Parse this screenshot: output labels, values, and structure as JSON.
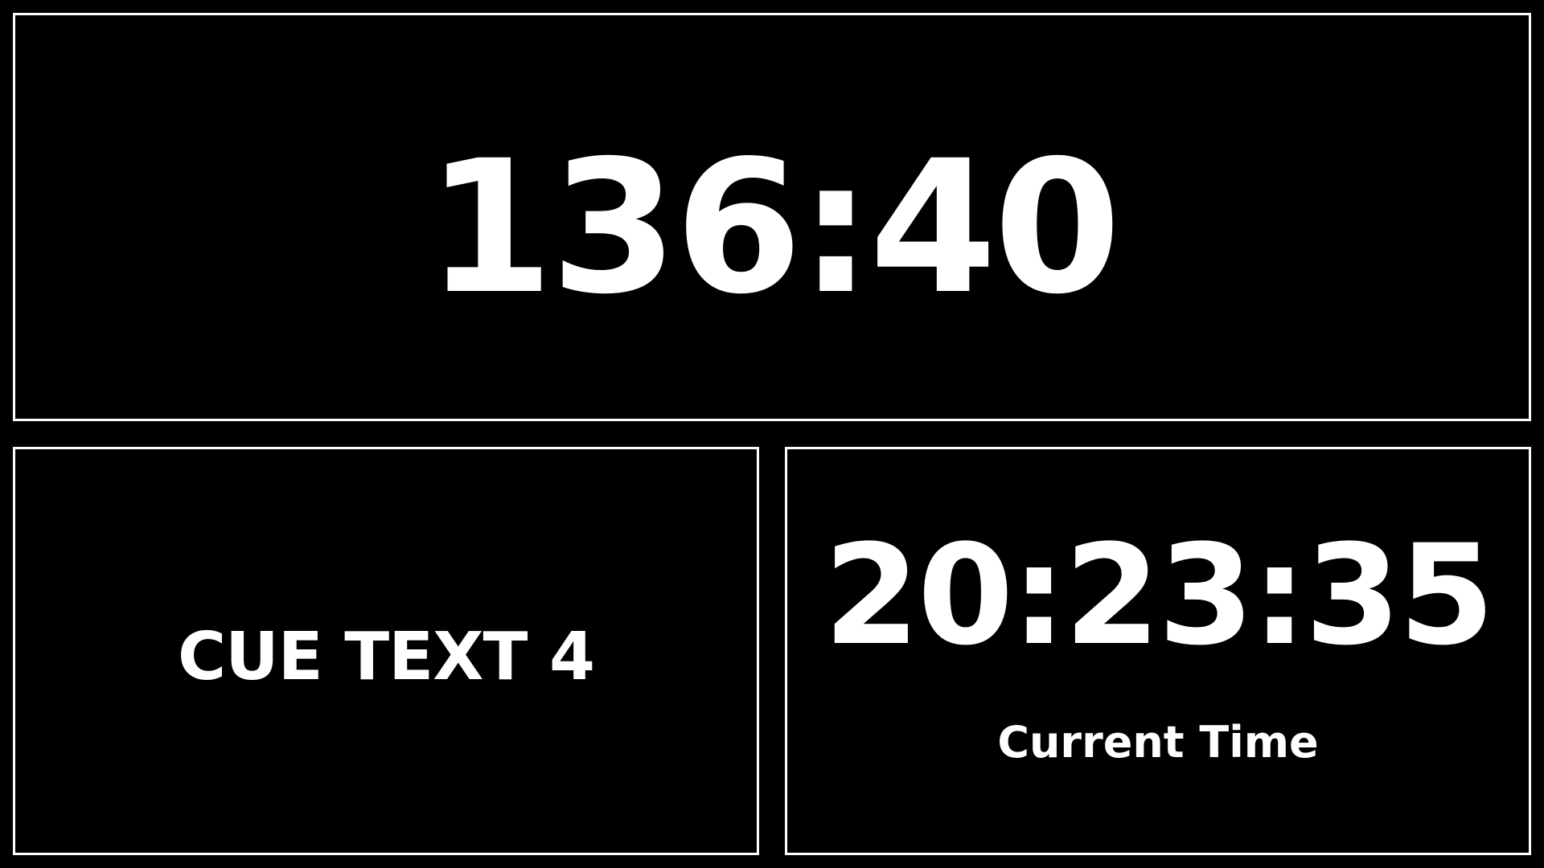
{
  "countdown": {
    "value": "136:40"
  },
  "cue": {
    "text": "CUE TEXT 4"
  },
  "clock": {
    "time": "20:23:35",
    "label": "Current Time"
  },
  "colors": {
    "background": "#000000",
    "foreground": "#ffffff",
    "border": "#ffffff"
  }
}
